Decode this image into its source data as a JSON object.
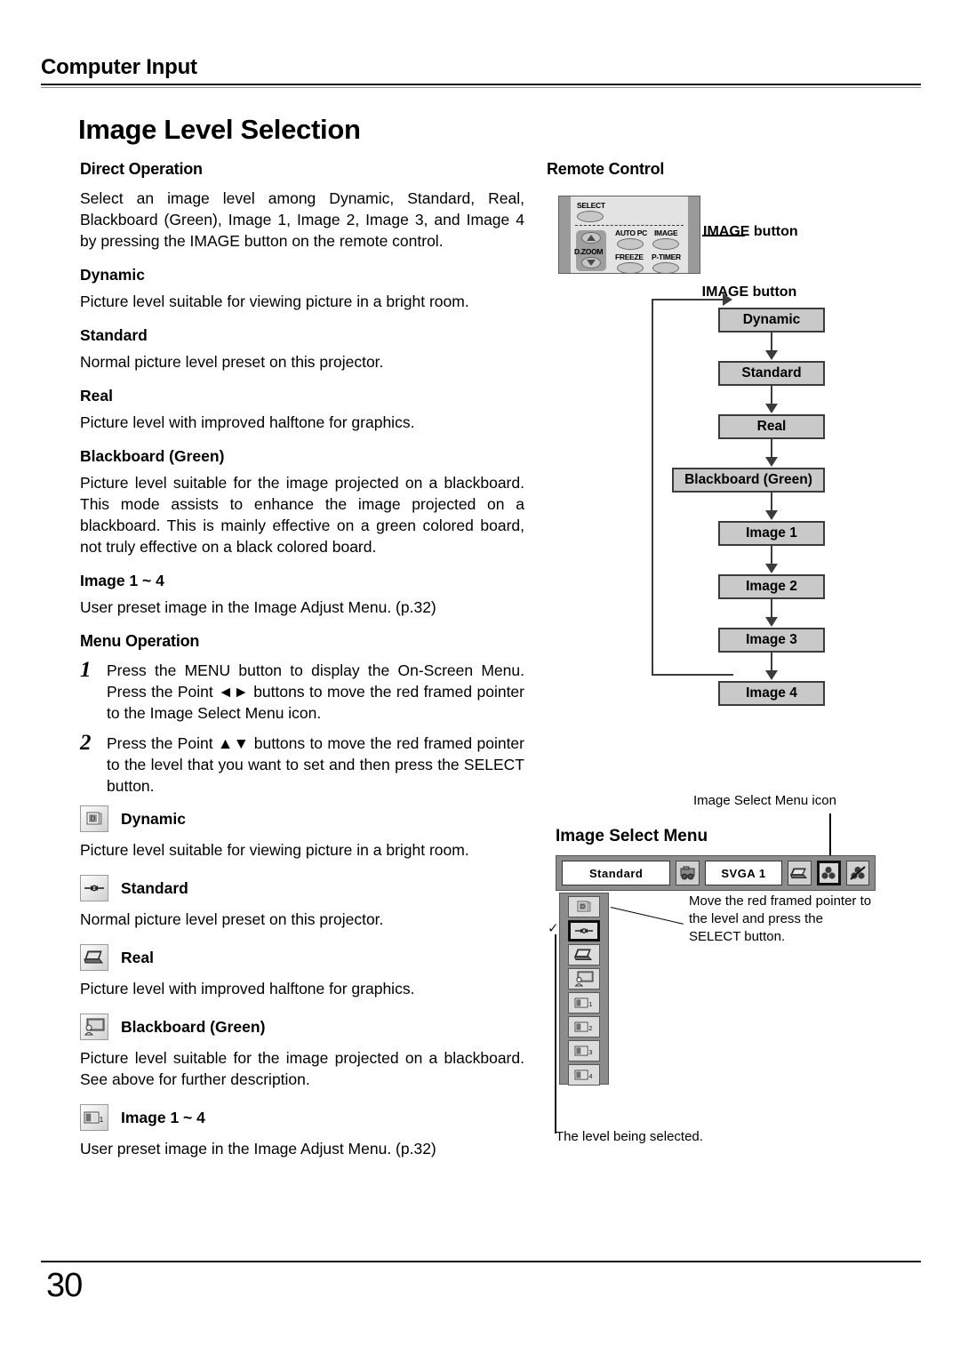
{
  "header": {
    "chapter": "Computer Input"
  },
  "title": "Image Level Selection",
  "page_number": "30",
  "left": {
    "direct_operation_heading": "Direct Operation",
    "direct_operation_text": "Select an image level among Dynamic, Standard, Real, Blackboard (Green), Image 1, Image 2, Image 3, and Image 4 by pressing the IMAGE button on the remote control.",
    "levels": [
      {
        "term": "Dynamic",
        "desc": "Picture level suitable for viewing picture in a bright room."
      },
      {
        "term": "Standard",
        "desc": "Normal picture level preset on this projector."
      },
      {
        "term": "Real",
        "desc": "Picture level with improved halftone for graphics."
      },
      {
        "term": "Blackboard (Green)",
        "desc": "Picture level suitable for the image projected on a blackboard.  This mode assists to enhance the image projected on a blackboard.  This is mainly effective on a green colored board, not truly effective on a black colored board."
      },
      {
        "term": "Image 1 ~ 4",
        "desc": "User preset image in the Image Adjust Menu. (p.32)"
      }
    ],
    "menu_operation_heading": "Menu Operation",
    "steps": [
      {
        "num": "1",
        "text": "Press the MENU button to display the On-Screen Menu.  Press the Point ◄► buttons to move the red framed pointer to the Image Select Menu icon."
      },
      {
        "num": "2",
        "text": "Press the Point ▲▼ buttons to move the red framed pointer to the level that you want to set and then press the SELECT button."
      }
    ],
    "menu_levels": [
      {
        "icon": "dynamic-icon",
        "term": "Dynamic",
        "desc": "Picture level suitable for viewing picture in a bright room."
      },
      {
        "icon": "standard-icon",
        "term": "Standard",
        "desc": "Normal picture level preset on this projector."
      },
      {
        "icon": "real-icon",
        "term": "Real",
        "desc": "Picture level with improved halftone for graphics."
      },
      {
        "icon": "blackboard-icon",
        "term": "Blackboard (Green)",
        "desc": "Picture level suitable for the image projected on a blackboard.  See above for further description."
      },
      {
        "icon": "image1-icon",
        "term": "Image 1 ~ 4",
        "desc": "User preset image in the Image Adjust Menu. (p.32)"
      }
    ]
  },
  "right": {
    "remote_control_heading": "Remote Control",
    "remote": {
      "select_label": "SELECT",
      "dzoom_label": "D.ZOOM",
      "autopc_label": "AUTO PC",
      "image_label": "IMAGE",
      "freeze_label": "FREEZE",
      "ptimer_label": "P-TIMER"
    },
    "remote_callout": "IMAGE button",
    "flow": {
      "title": "IMAGE button",
      "nodes": [
        "Dynamic",
        "Standard",
        "Real",
        "Blackboard (Green)",
        "Image 1",
        "Image 2",
        "Image 3",
        "Image 4"
      ]
    },
    "image_select_menu": {
      "icon_callout": "Image Select Menu icon",
      "heading": "Image Select Menu",
      "bar": {
        "level_value": "Standard",
        "input_value": "SVGA 1"
      },
      "side_icons": [
        "dynamic-icon",
        "standard-icon",
        "real-icon",
        "blackboard-icon",
        "image1-icon",
        "image2-icon",
        "image3-icon",
        "image4-icon"
      ],
      "note": "Move the red framed pointer to the level and press the SELECT button.",
      "bottom_note": "The level being selected."
    }
  }
}
